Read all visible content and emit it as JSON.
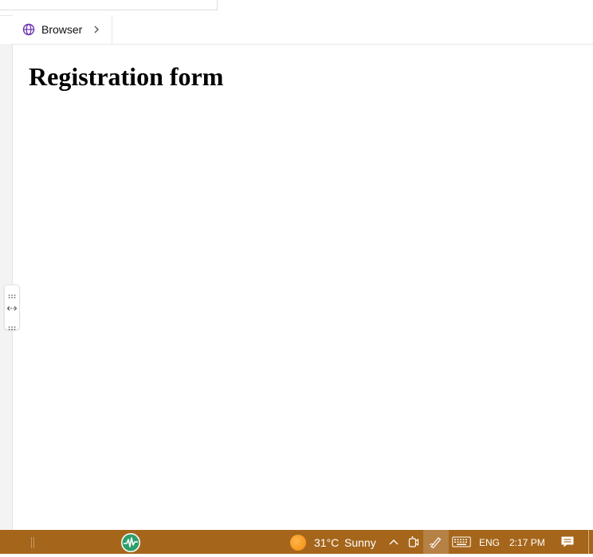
{
  "tab": {
    "label": "Browser"
  },
  "page": {
    "heading": "Registration form"
  },
  "taskbar": {
    "weather": {
      "temperature": "31°C",
      "condition": "Sunny"
    },
    "language": "ENG",
    "time": "2:17 PM"
  },
  "icons": {
    "tab": "globe-icon",
    "chevron": "chevron-right-icon",
    "app": "activity-monitor-icon",
    "weather": "sun-icon",
    "tray": [
      "chevron-up-icon",
      "camera-icon",
      "pen-icon",
      "keyboard-icon",
      "notification-icon"
    ]
  },
  "colors": {
    "taskbar": "#a5661b",
    "accent": "#6b2fb3",
    "app_icon": "#2e9e6b"
  }
}
